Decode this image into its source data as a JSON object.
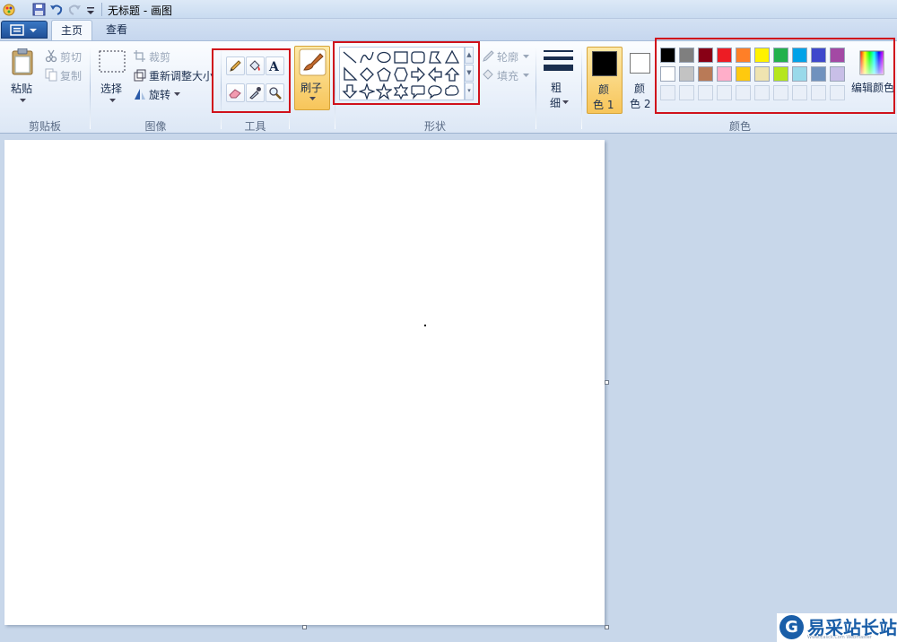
{
  "window": {
    "title": "无标题 - 画图"
  },
  "tabs": {
    "home": "主页",
    "view": "查看"
  },
  "clipboard": {
    "paste": "粘贴",
    "cut": "剪切",
    "copy": "复制",
    "label": "剪贴板"
  },
  "image": {
    "select": "选择",
    "crop": "裁剪",
    "resize": "重新调整大小",
    "rotate": "旋转",
    "label": "图像"
  },
  "tools": {
    "label": "工具"
  },
  "brushes": {
    "label": "刷子"
  },
  "shapes": {
    "outline": "轮廓",
    "fill": "填充",
    "label": "形状"
  },
  "size": {
    "line1": "粗",
    "line2": "细"
  },
  "colors": {
    "color1_a": "颜",
    "color1_b": "色 1",
    "color2_a": "颜",
    "color2_b": "色 2",
    "edit": "编辑颜色",
    "label": "颜色",
    "color1_value": "#000000",
    "color2_value": "#ffffff",
    "row1": [
      "#000000",
      "#7f7f7f",
      "#880015",
      "#ed1c24",
      "#ff7f27",
      "#fff200",
      "#22b14c",
      "#00a2e8",
      "#3f48cc",
      "#a349a4"
    ],
    "row2": [
      "#ffffff",
      "#c3c3c3",
      "#b97a57",
      "#ffaec9",
      "#ffc90e",
      "#efe4b0",
      "#b5e61d",
      "#99d9ea",
      "#7092be",
      "#c8bfe7"
    ]
  },
  "watermark": {
    "logo": "G",
    "text": "易采站长站",
    "sub": "Www.Easck.Com Webmaster"
  }
}
